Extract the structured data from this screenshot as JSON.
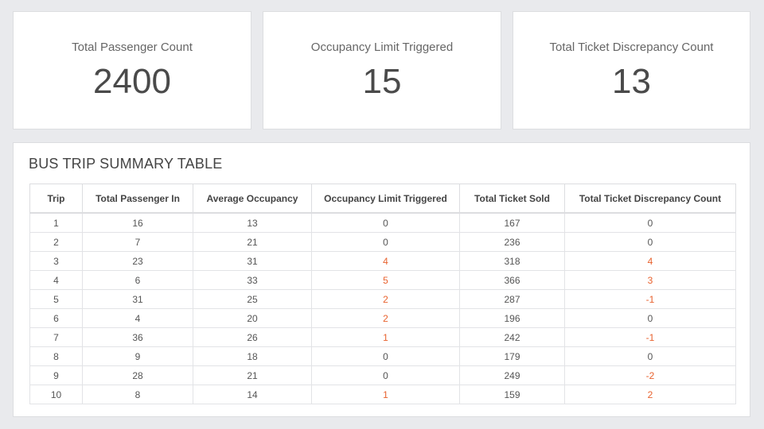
{
  "kpis": [
    {
      "title": "Total Passenger Count",
      "value": "2400"
    },
    {
      "title": "Occupancy Limit Triggered",
      "value": "15"
    },
    {
      "title": "Total Ticket Discrepancy Count",
      "value": "13"
    }
  ],
  "summary": {
    "title": "BUS TRIP SUMMARY TABLE",
    "columns": [
      "Trip",
      "Total Passenger In",
      "Average Occupancy",
      "Occupancy Limit Triggered",
      "Total Ticket Sold",
      "Total Ticket Discrepancy Count"
    ],
    "rows": [
      [
        "1",
        "16",
        "13",
        "0",
        "167",
        "0"
      ],
      [
        "2",
        "7",
        "21",
        "0",
        "236",
        "0"
      ],
      [
        "3",
        "23",
        "31",
        "4",
        "318",
        "4"
      ],
      [
        "4",
        "6",
        "33",
        "5",
        "366",
        "3"
      ],
      [
        "5",
        "31",
        "25",
        "2",
        "287",
        "-1"
      ],
      [
        "6",
        "4",
        "20",
        "2",
        "196",
        "0"
      ],
      [
        "7",
        "36",
        "26",
        "1",
        "242",
        "-1"
      ],
      [
        "8",
        "9",
        "18",
        "0",
        "179",
        "0"
      ],
      [
        "9",
        "28",
        "21",
        "0",
        "249",
        "-2"
      ],
      [
        "10",
        "8",
        "14",
        "1",
        "159",
        "2"
      ]
    ]
  },
  "colors": {
    "highlight": "#e8622e",
    "background": "#e9eaed"
  }
}
